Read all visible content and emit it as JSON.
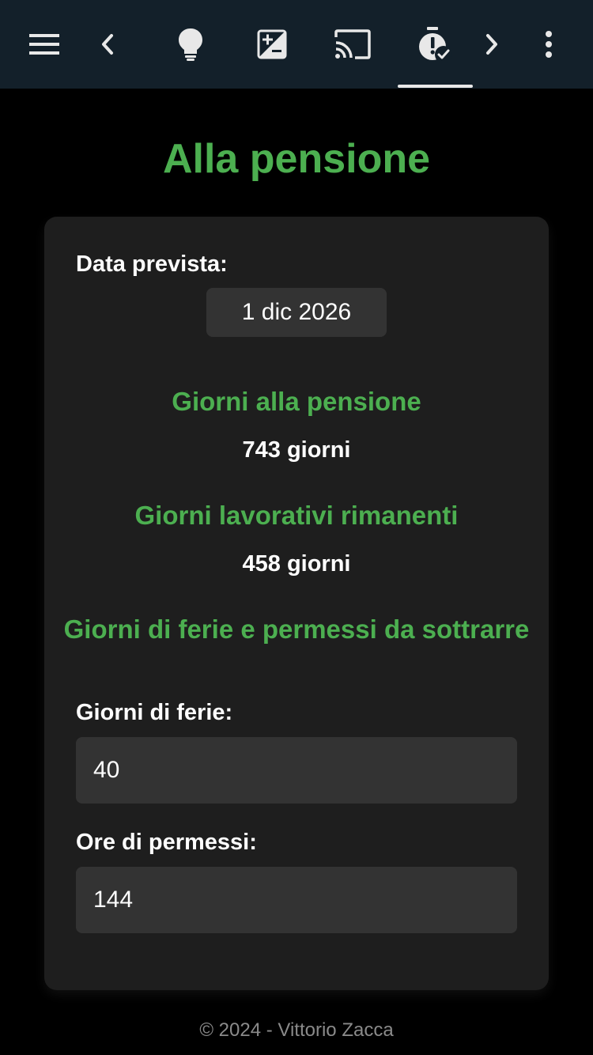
{
  "toolbar": {
    "items": [
      {
        "icon": "menu-icon"
      },
      {
        "icon": "chevron-left-icon"
      },
      {
        "icon": "lightbulb-icon"
      },
      {
        "icon": "plus-minus-box-icon"
      },
      {
        "icon": "cast-icon"
      },
      {
        "icon": "timer-alert-icon",
        "active": true
      },
      {
        "icon": "chevron-right-icon"
      },
      {
        "icon": "more-vertical-icon"
      }
    ],
    "background": "#13202a",
    "icon_color": "#e8e8e8"
  },
  "page": {
    "title": "Alla pensione",
    "accent": "#4caf50"
  },
  "card": {
    "date_label": "Data prevista:",
    "date_value": "1 dic 2026",
    "days_title": "Giorni alla pensione",
    "days_value": "743 giorni",
    "workdays_title": "Giorni lavorativi rimanenti",
    "workdays_value": "458 giorni",
    "subtract_title": "Giorni di ferie e permessi da sottrarre",
    "holiday_label": "Giorni di ferie:",
    "holiday_value": "40",
    "permit_label": "Ore di permessi:",
    "permit_value": "144"
  },
  "footer": {
    "text": "© 2024 - Vittorio Zacca"
  }
}
